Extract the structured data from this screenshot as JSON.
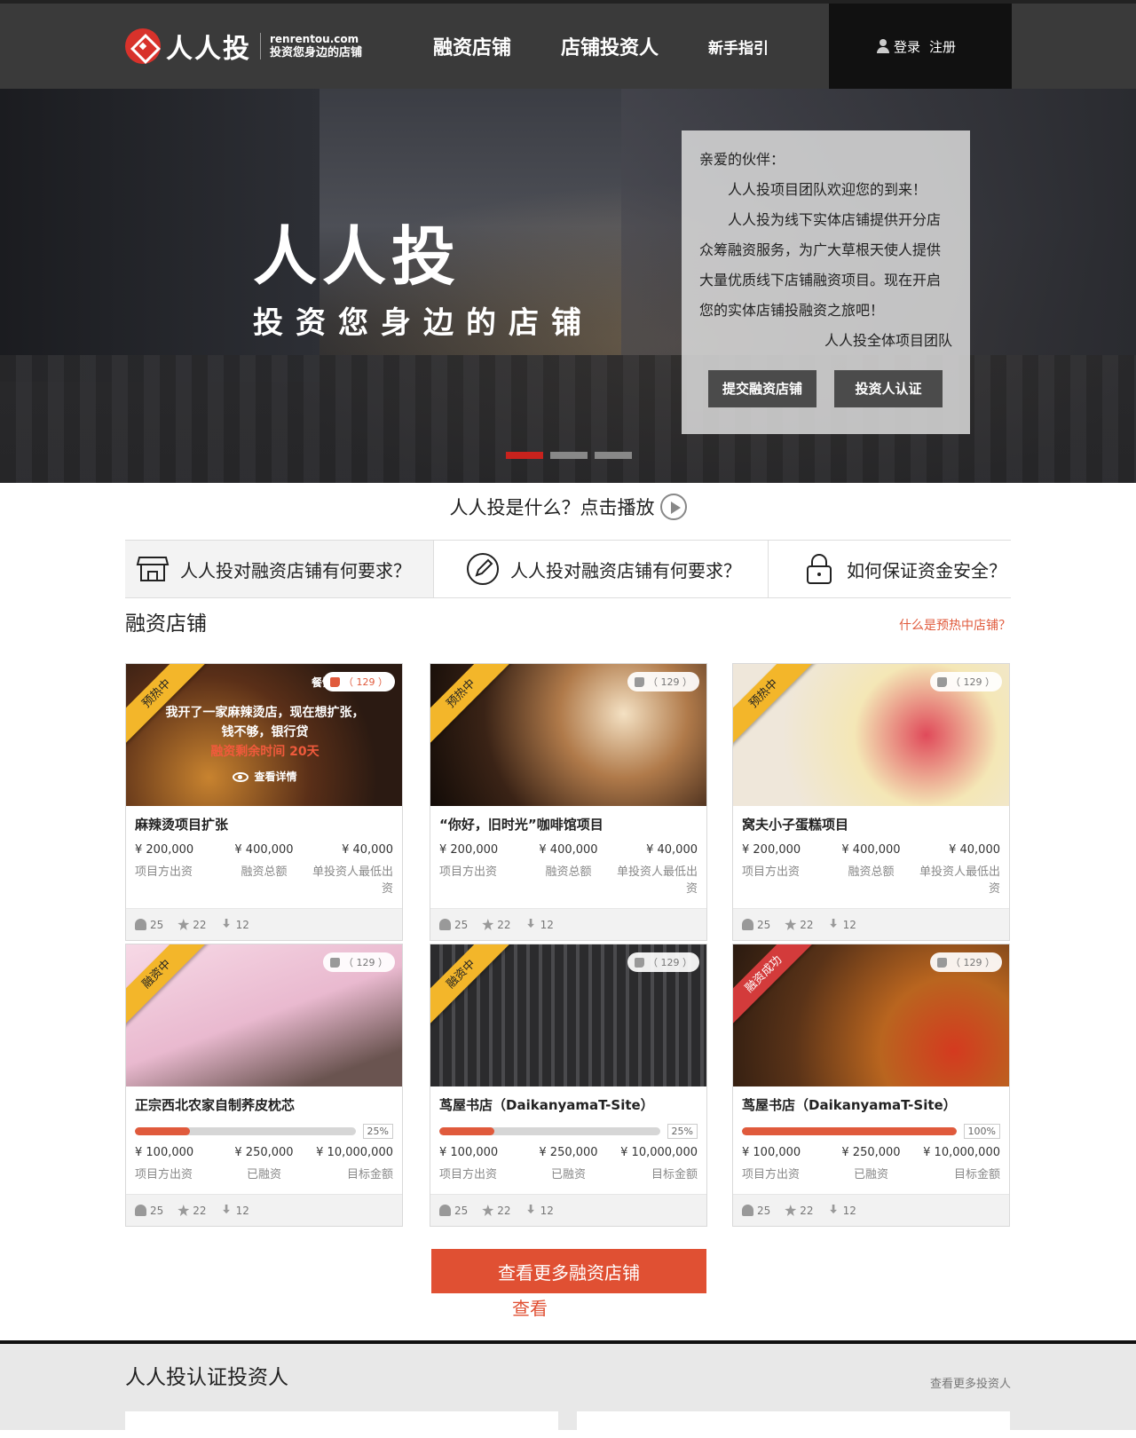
{
  "header": {
    "logo_name": "人人投",
    "logo_url": "renrentou.com",
    "logo_slogan": "投资您身边的店铺",
    "nav": [
      "融资店铺",
      "店铺投资人",
      "新手指引"
    ],
    "login": "登录",
    "register": "注册"
  },
  "hero": {
    "title": "人人投",
    "subtitle": "投资您身边的店铺",
    "welcome": {
      "greeting": "亲爱的伙伴：",
      "line1": "人人投项目团队欢迎您的到来！",
      "line2": "人人投为线下实体店铺提供开分店众筹融资服务，为广大草根天使人提供大量优质线下店铺融资项目。现在开启您的实体店铺投融资之旅吧！",
      "sign": "人人投全体项目团队",
      "btn_submit": "提交融资店铺",
      "btn_investor": "投资人认证"
    }
  },
  "intro": {
    "text": "人人投是什么？点击播放"
  },
  "faq": [
    {
      "text": "人人投对融资店铺有何要求？",
      "icon": "store-icon"
    },
    {
      "text": "人人投对融资店铺有何要求？",
      "icon": "pencil-icon"
    },
    {
      "text": "如何保证资金安全？",
      "icon": "lock-icon"
    }
  ],
  "section": {
    "title": "融资店铺",
    "link": "什么是预热中店铺？"
  },
  "cards_row1": [
    {
      "ribbon": "预热中",
      "category": "餐饮",
      "likes": "（ 129 ）",
      "overlay_line1": "我开了一家麻辣烫店，现在想扩张，",
      "overlay_line2": "钱不够，银行贷",
      "overlay_line3": "融资剩余时间 20天",
      "overlay_detail": "查看详情",
      "name": "麻辣烫项目扩张",
      "v1": "¥ 200,000",
      "v2": "¥ 400,000",
      "v3": "¥ 40,000",
      "l1": "项目方出资",
      "l2": "融资总额",
      "l3": "单投资人最低出资",
      "s1": "25",
      "s2": "22",
      "s3": "12"
    },
    {
      "ribbon": "预热中",
      "likes": "（ 129 ）",
      "name": "“你好，旧时光”咖啡馆项目",
      "v1": "¥ 200,000",
      "v2": "¥ 400,000",
      "v3": "¥ 40,000",
      "l1": "项目方出资",
      "l2": "融资总额",
      "l3": "单投资人最低出资",
      "s1": "25",
      "s2": "22",
      "s3": "12"
    },
    {
      "ribbon": "预热中",
      "likes": "（ 129 ）",
      "name": "窝夫小子蛋糕项目",
      "v1": "¥ 200,000",
      "v2": "¥ 400,000",
      "v3": "¥ 40,000",
      "l1": "项目方出资",
      "l2": "融资总额",
      "l3": "单投资人最低出资",
      "s1": "25",
      "s2": "22",
      "s3": "12"
    }
  ],
  "cards_row2": [
    {
      "ribbon": "融资中",
      "likes": "（ 129 ）",
      "name": "正宗西北农家自制荞皮枕芯",
      "progress": 0.25,
      "pct": "25%",
      "v1": "¥ 100,000",
      "v2": "¥ 250,000",
      "v3": "¥ 10,000,000",
      "l1": "项目方出资",
      "l2": "已融资",
      "l3": "目标金额",
      "s1": "25",
      "s2": "22",
      "s3": "12"
    },
    {
      "ribbon": "融资中",
      "likes": "（ 129 ）",
      "name": "茑屋书店（DaikanyamaT-Site）",
      "progress": 0.25,
      "pct": "25%",
      "v1": "¥ 100,000",
      "v2": "¥ 250,000",
      "v3": "¥ 10,000,000",
      "l1": "项目方出资",
      "l2": "已融资",
      "l3": "目标金额",
      "s1": "25",
      "s2": "22",
      "s3": "12"
    },
    {
      "ribbon": "融资成功",
      "likes": "（ 129 ）",
      "name": "茑屋书店（DaikanyamaT-Site）",
      "progress": 1.0,
      "pct": "100%",
      "v1": "¥ 100,000",
      "v2": "¥ 250,000",
      "v3": "¥ 10,000,000",
      "l1": "项目方出资",
      "l2": "已融资",
      "l3": "目标金额",
      "s1": "25",
      "s2": "22",
      "s3": "12"
    }
  ],
  "more": {
    "button": "查看更多融资店铺",
    "sub": "查看"
  },
  "investors": {
    "title": "人人投认证投资人",
    "link": "查看更多投资人"
  }
}
